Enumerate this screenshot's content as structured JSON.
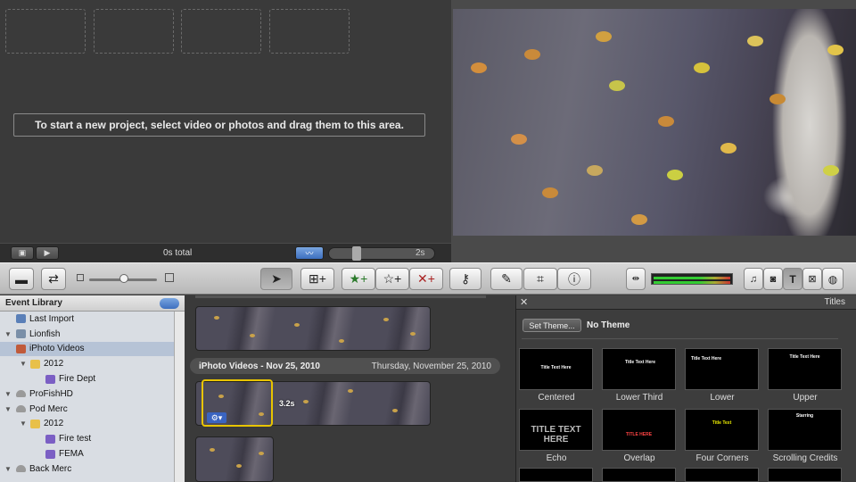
{
  "project": {
    "drop_hint": "To start a new project, select video or photos and drag them to this area.",
    "total": "0s total",
    "zoom_value": "2s"
  },
  "event_library": {
    "header": "Event Library",
    "items": [
      {
        "label": "Last Import",
        "level": 1,
        "icon": "monitor-icon"
      },
      {
        "label": "Lionfish",
        "level": 0,
        "icon": "computer-icon"
      },
      {
        "label": "iPhoto Videos",
        "level": 1,
        "icon": "iphoto-icon",
        "selected": true
      },
      {
        "label": "2012",
        "level": 1,
        "icon": "folder-icon"
      },
      {
        "label": "Fire Dept",
        "level": 2,
        "icon": "event-star-icon"
      },
      {
        "label": "ProFishHD",
        "level": 0,
        "icon": "drive-icon"
      },
      {
        "label": "Pod Merc",
        "level": 0,
        "icon": "drive-icon"
      },
      {
        "label": "2012",
        "level": 1,
        "icon": "folder-icon"
      },
      {
        "label": "Fire test",
        "level": 2,
        "icon": "event-star-icon"
      },
      {
        "label": "FEMA",
        "level": 2,
        "icon": "event-star-icon"
      },
      {
        "label": "Back Merc",
        "level": 0,
        "icon": "drive-icon"
      }
    ]
  },
  "browser": {
    "event_title": "iPhoto Videos - Nov 25, 2010",
    "event_date": "Thursday, November 25, 2010",
    "clip_duration": "3.2s"
  },
  "titles_panel": {
    "header": "Titles",
    "set_theme": "Set Theme...",
    "theme_name": "No Theme",
    "tiles": [
      {
        "label": "Centered",
        "preview": "Title Text Here"
      },
      {
        "label": "Lower Third",
        "preview": "Title Text Here"
      },
      {
        "label": "Lower",
        "preview": "Title Text Here"
      },
      {
        "label": "Upper",
        "preview": "Title Text Here"
      },
      {
        "label": "Echo",
        "preview": "TITLE TEXT HERE"
      },
      {
        "label": "Overlap",
        "preview": "TITLE HERE"
      },
      {
        "label": "Four Corners",
        "preview": "Title Text"
      },
      {
        "label": "Scrolling Credits",
        "preview": "Starring"
      }
    ]
  }
}
